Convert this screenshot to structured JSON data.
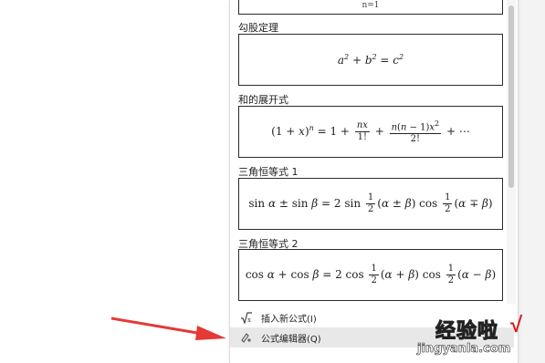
{
  "top_card": {
    "formula_fragment": "n=1"
  },
  "formulas": [
    {
      "title": "勾股定理",
      "formula": "a² + b² = c²"
    },
    {
      "title": "和的展开式",
      "formula": "(1 + x)ⁿ = 1 + nx/1! + n(n − 1)x²/2! + ⋯"
    },
    {
      "title": "三角恒等式 1",
      "formula": "sin α ± sin β = 2 sin ½(α ± β) cos ½(α ∓ β)"
    },
    {
      "title": "三角恒等式 2",
      "formula": "cos α + cos β = 2 cos ½(α + β) cos ½(α − β)"
    }
  ],
  "menu": {
    "insert_new_label": "插入新公式(I)",
    "editor_label": "公式编辑器(Q)"
  },
  "watermark": {
    "brand": "经验啦",
    "url": "jingyanla.com",
    "check": "√"
  },
  "colors": {
    "arrow": "#e53935",
    "hover": "#e8e8e8"
  }
}
